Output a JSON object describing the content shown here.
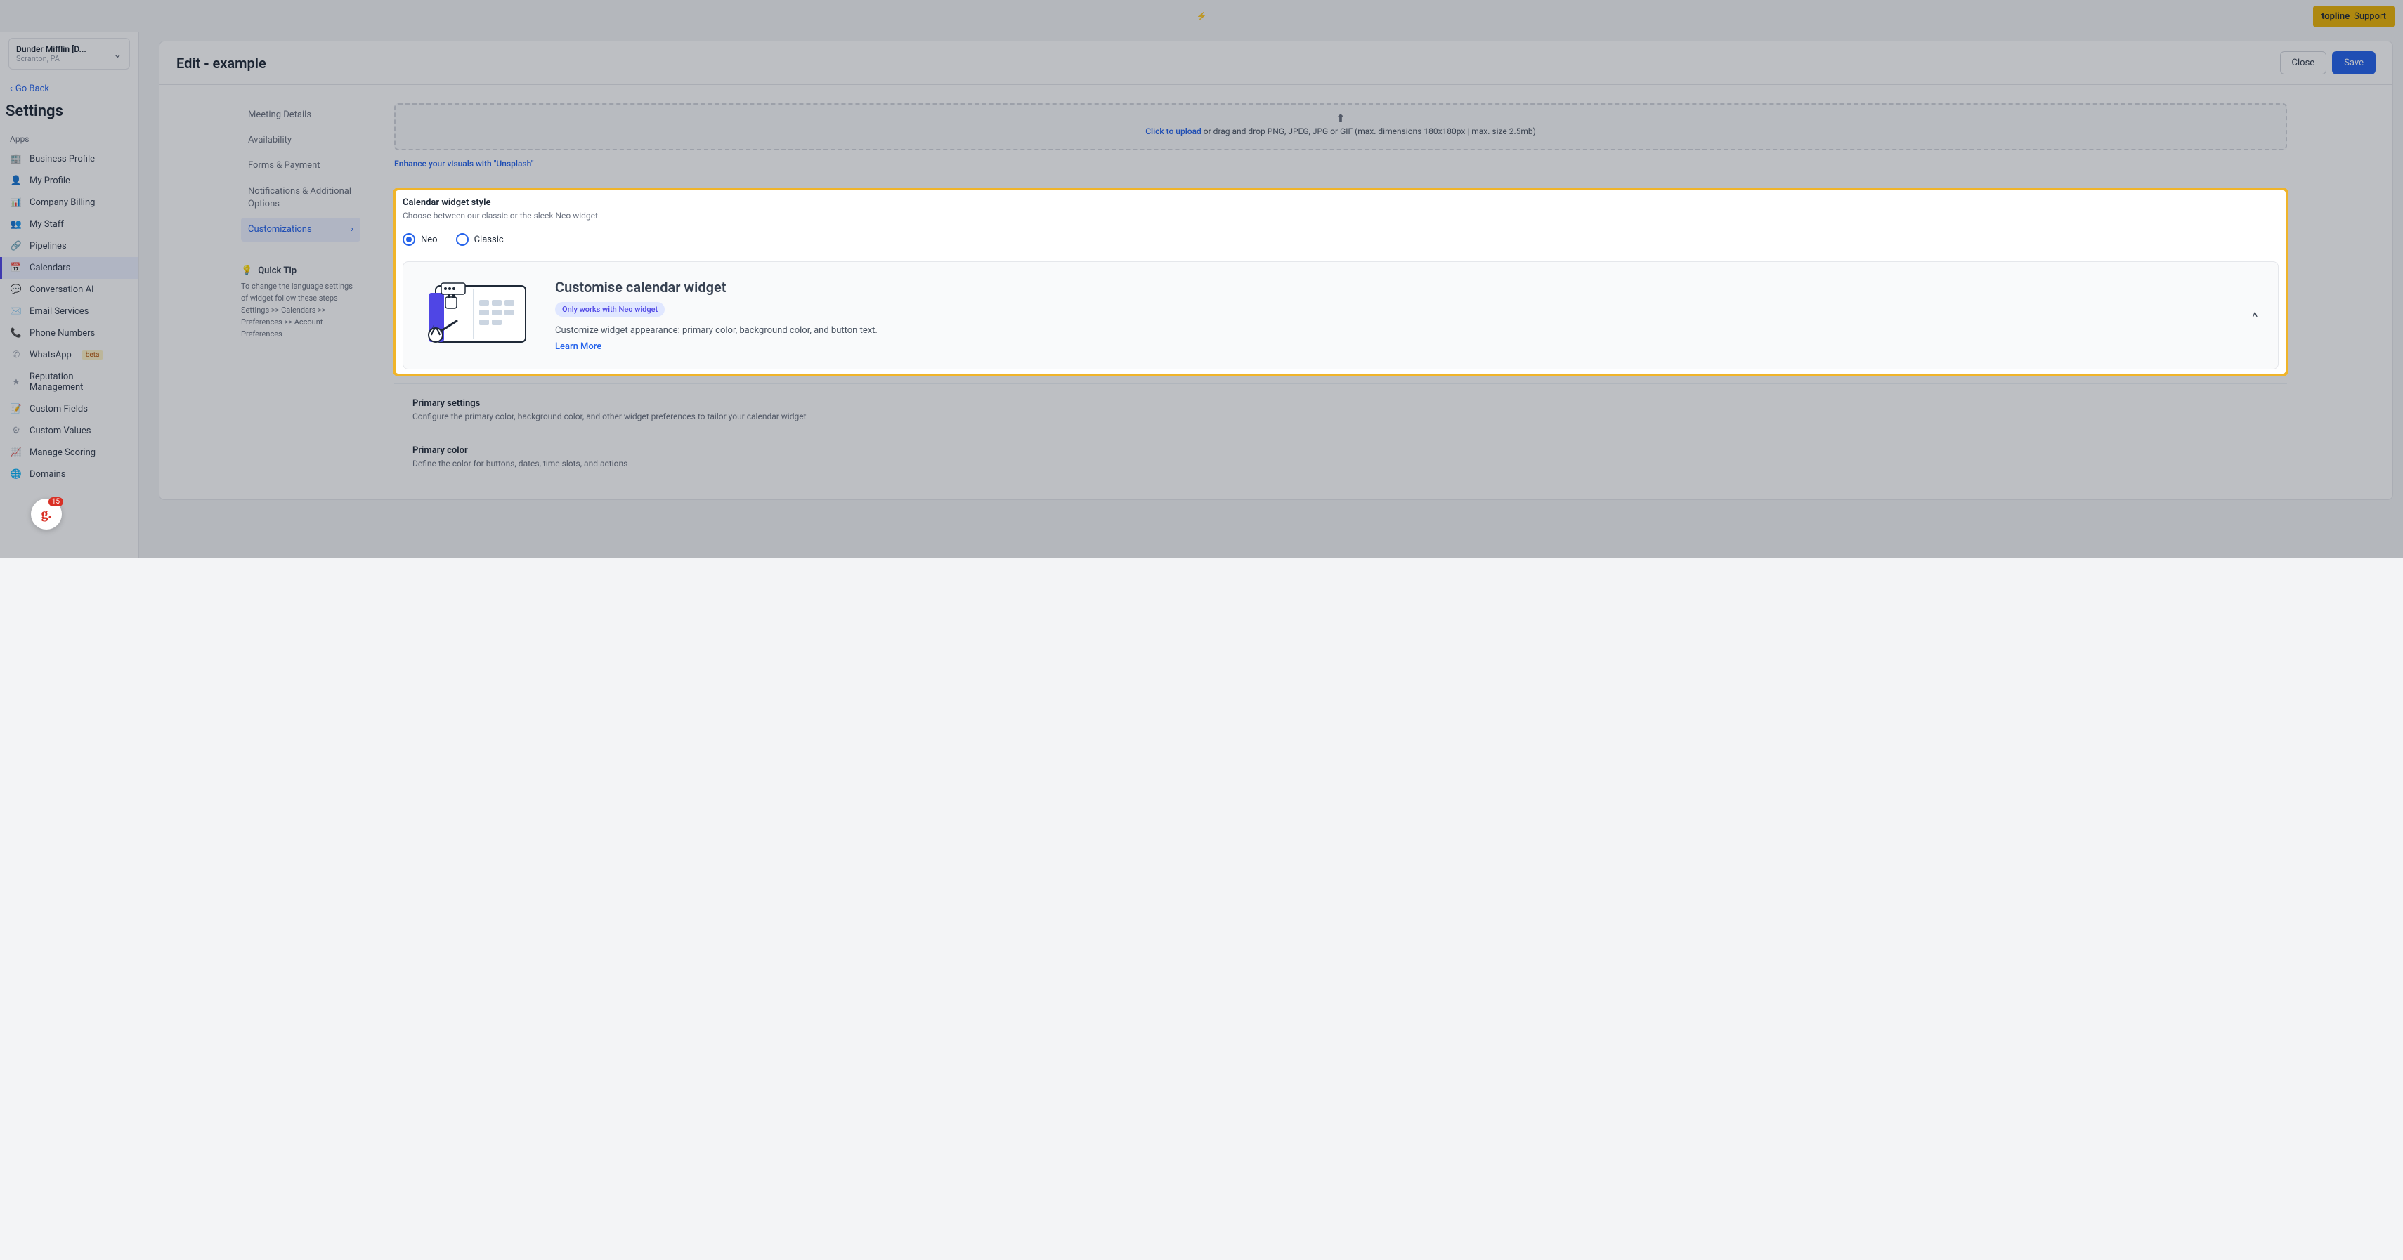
{
  "topbar": {
    "center_text": "",
    "support_brand": "topline",
    "support_label": "Support"
  },
  "org": {
    "name": "Dunder Mifflin [D...",
    "location": "Scranton, PA"
  },
  "nav": {
    "go_back": "Go Back",
    "settings_title": "Settings",
    "group_label": "Apps",
    "items": [
      {
        "icon": "🏢",
        "label": "Business Profile"
      },
      {
        "icon": "👤",
        "label": "My Profile"
      },
      {
        "icon": "📊",
        "label": "Company Billing"
      },
      {
        "icon": "👥",
        "label": "My Staff"
      },
      {
        "icon": "🔗",
        "label": "Pipelines"
      },
      {
        "icon": "📅",
        "label": "Calendars",
        "active": true
      },
      {
        "icon": "💬",
        "label": "Conversation AI"
      },
      {
        "icon": "✉️",
        "label": "Email Services"
      },
      {
        "icon": "📞",
        "label": "Phone Numbers"
      },
      {
        "icon": "✆",
        "label": "WhatsApp",
        "beta": "beta"
      },
      {
        "icon": "★",
        "label": "Reputation Management"
      },
      {
        "icon": "📝",
        "label": "Custom Fields"
      },
      {
        "icon": "⚙",
        "label": "Custom Values"
      },
      {
        "icon": "📈",
        "label": "Manage Scoring"
      },
      {
        "icon": "🌐",
        "label": "Domains"
      }
    ]
  },
  "header": {
    "title": "Edit - example",
    "close": "Close",
    "save": "Save"
  },
  "config_tabs": [
    "Meeting Details",
    "Availability",
    "Forms & Payment",
    "Notifications & Additional Options",
    "Customizations"
  ],
  "quicktip": {
    "title": "Quick Tip",
    "body": "To change the language settings of widget follow these steps Settings >> Calendars >> Preferences >> Account Preferences"
  },
  "upload": {
    "link": "Click to upload",
    "rest": " or drag and drop PNG, JPEG, JPG or GIF (max. dimensions 180x180px | max. size 2.5mb)"
  },
  "unsplash": "Enhance your visuals with \"Unsplash\"",
  "widget": {
    "title": "Calendar widget style",
    "subtitle": "Choose between our classic or the sleek Neo widget",
    "radio_neo": "Neo",
    "radio_classic": "Classic",
    "card_title": "Customise calendar widget",
    "pill": "Only works with Neo widget",
    "desc": "Customize widget appearance: primary color, background color, and button text.",
    "learn": "Learn More"
  },
  "primary": {
    "settings_title": "Primary settings",
    "settings_sub": "Configure the primary color, background color, and other widget preferences to tailor your calendar widget",
    "color_title": "Primary color",
    "color_sub": "Define the color for buttons, dates, time slots, and actions"
  },
  "float_badge": {
    "count": "15"
  }
}
